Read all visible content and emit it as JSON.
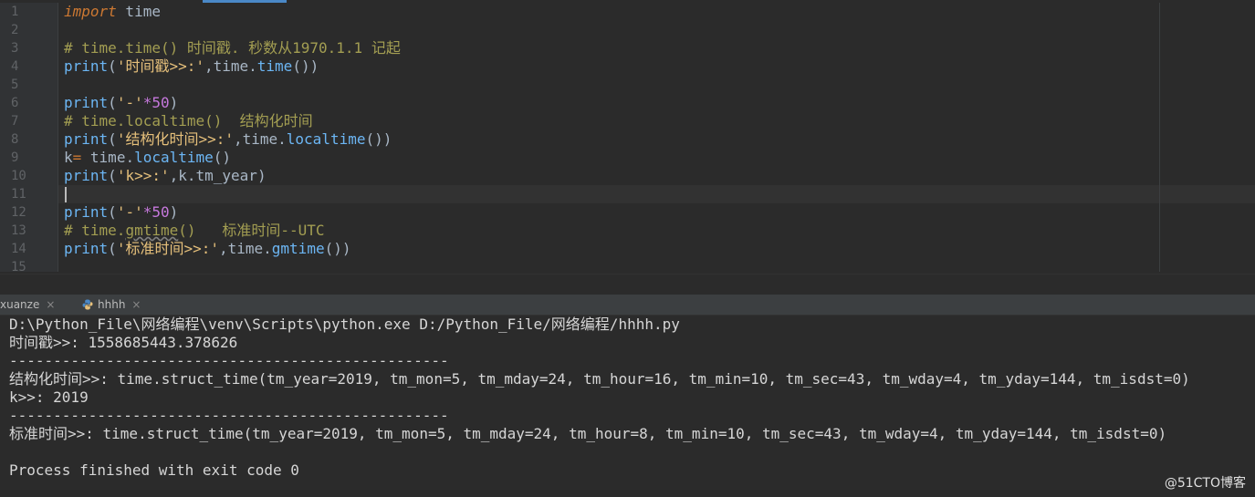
{
  "editor": {
    "line_numbers": [
      "1",
      "2",
      "3",
      "4",
      "5",
      "6",
      "7",
      "8",
      "9",
      "10",
      "11",
      "12",
      "13",
      "14",
      "15"
    ],
    "code": {
      "l1_kw": "import",
      "l1_rest": " time",
      "l3_comment": "# time.time() 时间戳. 秒数从1970.1.1 记起",
      "l4_print": "print",
      "l4_open": "(",
      "l4_str": "'时间戳>>:'",
      "l4_mid": ",time.",
      "l4_fn": "time",
      "l4_close": "())",
      "l6_print": "print",
      "l6_open": "(",
      "l6_str": "'-'",
      "l6_op": "*",
      "l6_num": "50",
      "l6_close": ")",
      "l7_comment": "# time.localtime()  结构化时间",
      "l8_print": "print",
      "l8_open": "(",
      "l8_str": "'结构化时间>>:'",
      "l8_mid": ",time.",
      "l8_fn": "localtime",
      "l8_close": "())",
      "l9_var": "k",
      "l9_op": "=",
      "l9_mid": " time.",
      "l9_fn": "localtime",
      "l9_close": "()",
      "l10_print": "print",
      "l10_open": "(",
      "l10_str": "'k>>:'",
      "l10_rest": ",k.tm_year)",
      "l12_print": "print",
      "l12_open": "(",
      "l12_str": "'-'",
      "l12_op": "*",
      "l12_num": "50",
      "l12_close": ")",
      "l13_comment_a": "# time.",
      "l13_comment_b": "gmtime",
      "l13_comment_c": "()   标准时间--UTC",
      "l14_print": "print",
      "l14_open": "(",
      "l14_str": "'标准时间>>:'",
      "l14_mid": ",time.",
      "l14_fn": "gmtime",
      "l14_close": "())"
    }
  },
  "run_tabs": [
    {
      "label": "xuanze",
      "close": "×"
    },
    {
      "label": "hhhh",
      "close": "×"
    }
  ],
  "console": [
    "D:\\Python_File\\网络编程\\venv\\Scripts\\python.exe D:/Python_File/网络编程/hhhh.py",
    "时间戳>>: 1558685443.378626",
    "--------------------------------------------------",
    "结构化时间>>: time.struct_time(tm_year=2019, tm_mon=5, tm_mday=24, tm_hour=16, tm_min=10, tm_sec=43, tm_wday=4, tm_yday=144, tm_isdst=0)",
    "k>>: 2019",
    "--------------------------------------------------",
    "标准时间>>: time.struct_time(tm_year=2019, tm_mon=5, tm_mday=24, tm_hour=8, tm_min=10, tm_sec=43, tm_wday=4, tm_yday=144, tm_isdst=0)",
    "",
    "Process finished with exit code 0"
  ],
  "watermark": "@51CTO博客",
  "colors": {
    "background": "#2b2b2b",
    "keyword": "#cc7832",
    "function": "#6cb6f4",
    "string": "#e6c07b",
    "comment": "#a39e52",
    "number": "#c678dd"
  }
}
